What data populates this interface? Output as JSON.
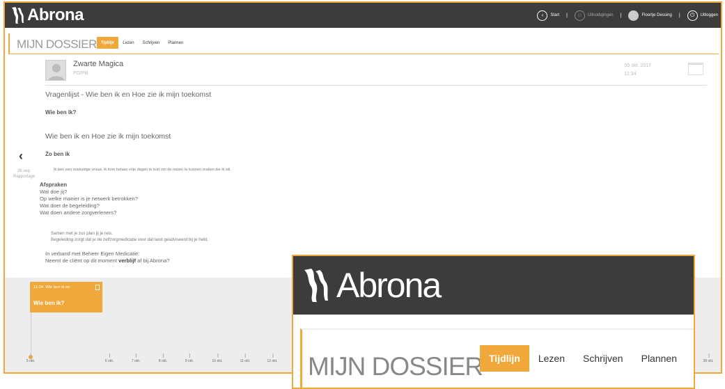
{
  "app": {
    "brand": "Abrona"
  },
  "topnav": {
    "start": "Start",
    "invitations": "Uitnodigingen",
    "user": "Floortje Dessing",
    "logout": "Uitloggen"
  },
  "header": {
    "title": "MIJN DOSSIER",
    "tabs": [
      "Tijdlijn",
      "Lezen",
      "Schrijven",
      "Plannen"
    ],
    "active_tab": "Tijdlijn"
  },
  "entry": {
    "author": "Zwarte Magica",
    "role": "PO/PB",
    "date": "05 okt. 2017",
    "time": "11:34",
    "title": "Vragenlijst - Wie ben ik en Hoe zie ik mijn toekomst",
    "heading1": "Wie ben ik?",
    "title2": "Wie ben ik en Hoe zie ik mijn toekomst",
    "heading2": "Zo ben ik",
    "text1": "Ik ben een reislustige vrouw. ik kom helaas vrije dagen te kort om de reizen te kunnen maken die ik wil.",
    "heading3": "Afspraken",
    "questions": [
      "Wat doe jij?",
      "Op welke manier is je netwerk betrokken?",
      "Wat doet de begeleiding?",
      "Wat doen andere zorgverleners?"
    ],
    "answers": [
      "Samen met je zus plan jij je reis.",
      "Begeleiding zorgt dat je de zelfzorgmedicatie voor dat land geadviseerd bij je hebt."
    ],
    "final1": "In verband met Beheer Eigen Medicatie:",
    "final2_pre": "Neemt de cliënt op dit moment ",
    "final2_bold": "verblijf",
    "final2_post": " af bij Abrona?"
  },
  "prev": {
    "date": "28 sep.",
    "label": "Rapportage"
  },
  "timeline": {
    "card_time": "11:34",
    "card_title": "Wie ben ik en",
    "card_heading": "Wie ben ik?",
    "ticks": [
      "5 okt.",
      "6 okt.",
      "7 okt.",
      "8 okt.",
      "9 okt.",
      "10 okt.",
      "11 okt.",
      "12 okt.",
      "28 okt."
    ]
  },
  "zoom": {
    "brand": "Abrona",
    "title": "MIJN DOSSIER",
    "tabs": [
      "Tijdlijn",
      "Lezen",
      "Schrijven",
      "Plannen"
    ]
  },
  "colors": {
    "accent": "#f1a83a",
    "topbar": "#3c3c3c"
  }
}
